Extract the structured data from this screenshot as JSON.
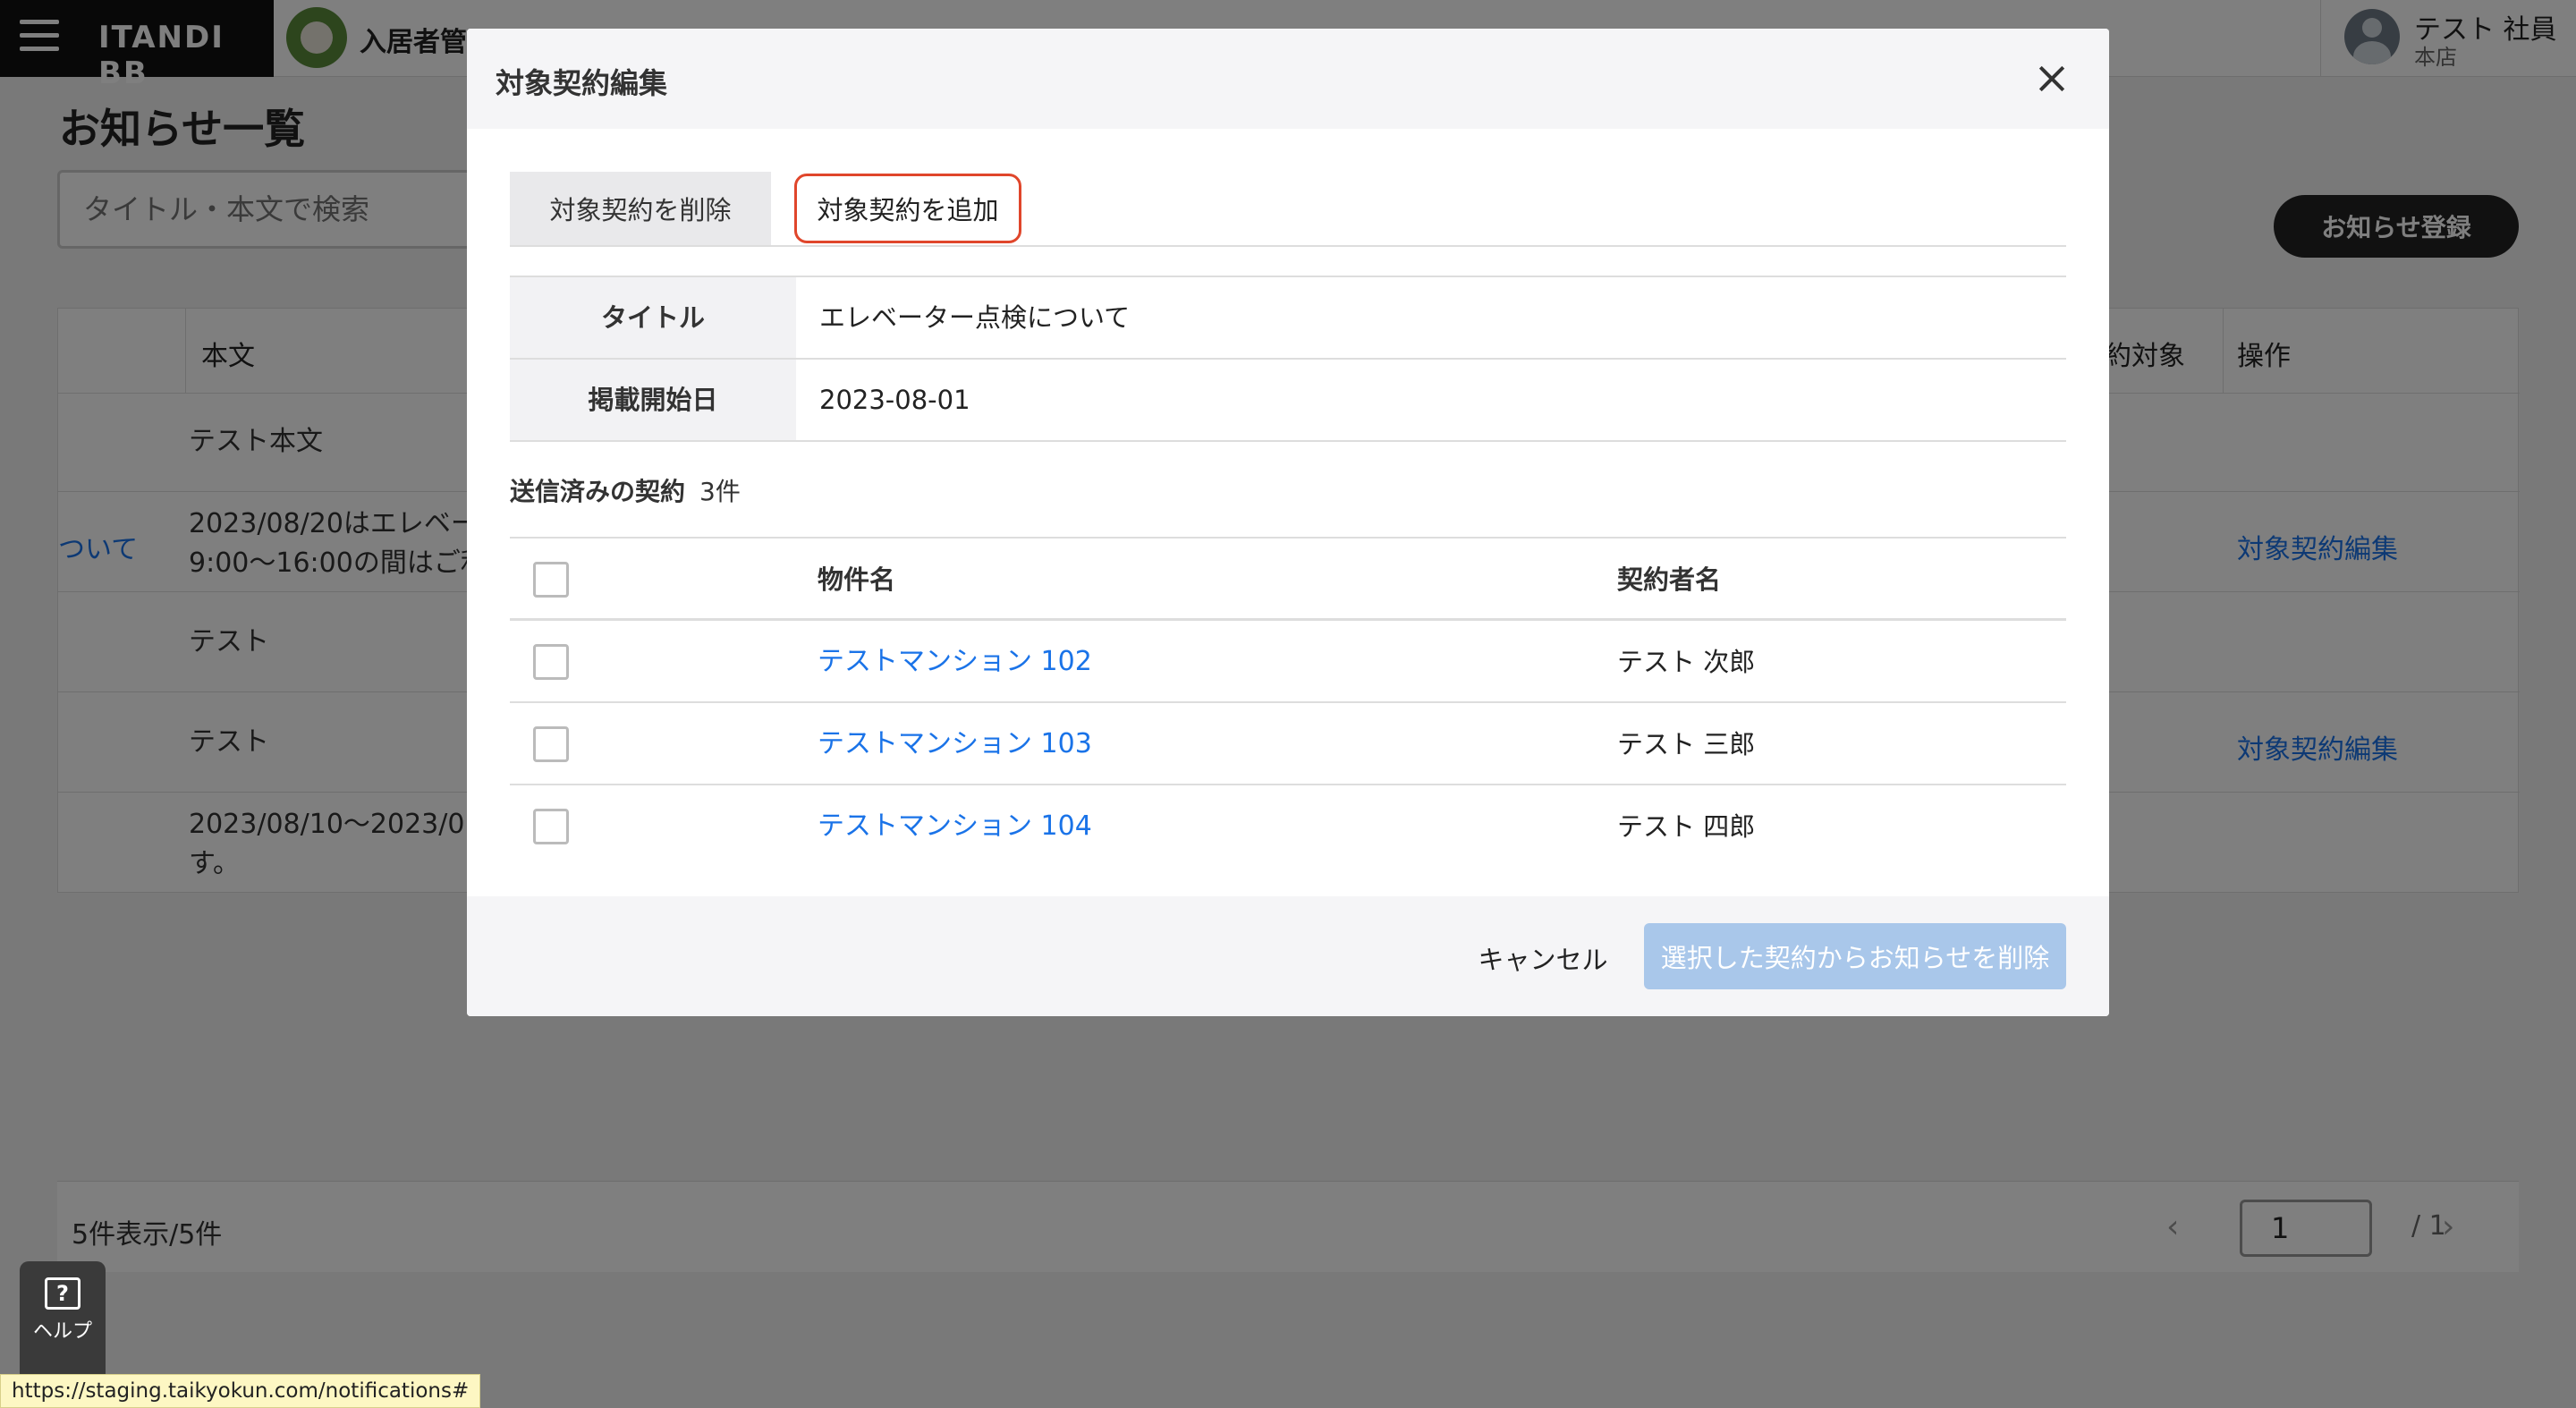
{
  "header": {
    "brand": "ITANDI BB",
    "app_name": "入居者管理",
    "user_name": "テスト 社員",
    "user_branch": "本店"
  },
  "page": {
    "title": "お知らせ一覧",
    "search_placeholder": "タイトル・本文で検索",
    "register_label": "お知らせ登録",
    "columns": {
      "body": "本文",
      "target_partial": "約対象",
      "actions": "操作"
    },
    "rows": [
      {
        "title_partial": "",
        "body_lines": [
          "テスト本文"
        ],
        "action": ""
      },
      {
        "title_partial": "ついて",
        "body_lines": [
          "2023/08/20はエレベー",
          "9:00〜16:00の間はご利"
        ],
        "action": "対象契約編集"
      },
      {
        "title_partial": "",
        "body_lines": [
          "テスト"
        ],
        "action": ""
      },
      {
        "title_partial": "",
        "body_lines": [
          "テスト"
        ],
        "action": "対象契約編集"
      },
      {
        "title_partial": "",
        "body_lines": [
          "2023/08/10〜2023/0",
          "す。"
        ],
        "action": ""
      }
    ],
    "footer_count": "5件表示/5件",
    "pager": {
      "current": "1",
      "total": "/ 1"
    }
  },
  "modal": {
    "title": "対象契約編集",
    "tab_delete": "対象契約を削除",
    "tab_add": "対象契約を追加",
    "info": [
      {
        "label": "タイトル",
        "value": "エレベーター点検について"
      },
      {
        "label": "掲載開始日",
        "value": "2023-08-01"
      }
    ],
    "sent_label": "送信済みの契約",
    "sent_count": "3件",
    "table_headers": {
      "property": "物件名",
      "contractor": "契約者名"
    },
    "contracts": [
      {
        "property": "テストマンション 102",
        "contractor": "テスト 次郎"
      },
      {
        "property": "テストマンション 103",
        "contractor": "テスト 三郎"
      },
      {
        "property": "テストマンション 104",
        "contractor": "テスト 四郎"
      }
    ],
    "cancel_label": "キャンセル",
    "primary_label": "選択した契約からお知らせを削除"
  },
  "help": {
    "label": "ヘルプ"
  },
  "status_url": "https://staging.taikyokun.com/notifications#",
  "colors": {
    "link": "#1a73e8",
    "highlight_border": "#e0462b",
    "primary_disabled": "#a9c7ea"
  }
}
